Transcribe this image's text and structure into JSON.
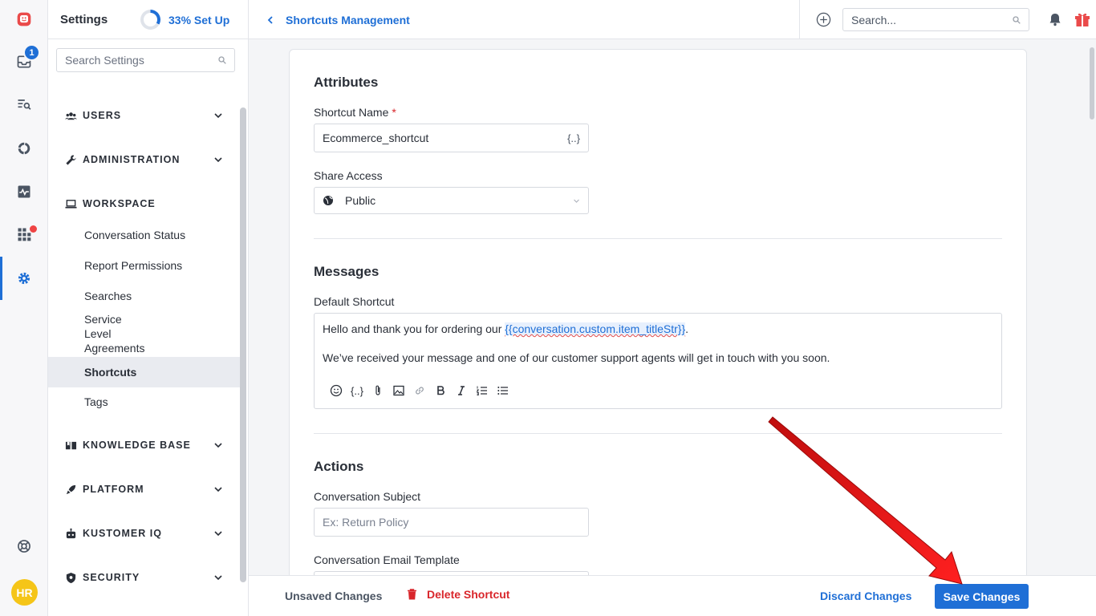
{
  "rail": {
    "badge_count": "1",
    "avatar_initials": "HR",
    "icons": [
      "kustomer-logo-icon",
      "inbox-icon",
      "search-list-icon",
      "reporting-icon",
      "activity-icon",
      "apps-grid-icon",
      "settings-gear-icon",
      "help-icon"
    ]
  },
  "sidebar": {
    "title": "Settings",
    "setup_label": "33% Set Up",
    "setup_progress": 0.33,
    "search_placeholder": "Search Settings",
    "sections": [
      {
        "label": "USERS",
        "icon": "users-icon"
      },
      {
        "label": "ADMINISTRATION",
        "icon": "wrench-icon"
      },
      {
        "label": "WORKSPACE",
        "icon": "laptop-icon"
      },
      {
        "label": "KNOWLEDGE BASE",
        "icon": "book-icon"
      },
      {
        "label": "PLATFORM",
        "icon": "rocket-icon"
      },
      {
        "label": "KUSTOMER IQ",
        "icon": "robot-icon"
      },
      {
        "label": "SECURITY",
        "icon": "shield-icon"
      }
    ],
    "workspace_items": [
      {
        "label": "Conversation Status"
      },
      {
        "label": "Report Permissions"
      },
      {
        "label": "Searches"
      },
      {
        "label": "Service Level Agreements"
      },
      {
        "label": "Shortcuts"
      },
      {
        "label": "Tags"
      }
    ]
  },
  "header": {
    "breadcrumb": "Shortcuts Management",
    "search_placeholder": "Search..."
  },
  "form": {
    "attributes_heading": "Attributes",
    "shortcut_name_label": "Shortcut Name",
    "required_mark": "*",
    "shortcut_name_value": "Ecommerce_shortcut",
    "variable_button": "{..}",
    "share_access_label": "Share Access",
    "share_access_value": "Public",
    "messages_heading": "Messages",
    "default_shortcut_label": "Default Shortcut",
    "message_line1_prefix": "Hello and thank you for ordering our ",
    "message_variable": "{{conversation.custom.item_titleStr}}",
    "message_line1_suffix": ".",
    "message_line2": "We’ve received your message and one of our customer support agents will get in touch with you soon.",
    "toolbar_variable": "{..}",
    "actions_heading": "Actions",
    "conversation_subject_label": "Conversation Subject",
    "conversation_subject_placeholder": "Ex: Return Policy",
    "conversation_email_template_label": "Conversation Email Template"
  },
  "footer": {
    "unsaved_label": "Unsaved Changes",
    "delete_label": "Delete Shortcut",
    "discard_label": "Discard Changes",
    "save_label": "Save Changes"
  },
  "colors": {
    "accent": "#1f6fd6",
    "danger": "#d9262b",
    "annotation_arrow": "#e01515"
  }
}
